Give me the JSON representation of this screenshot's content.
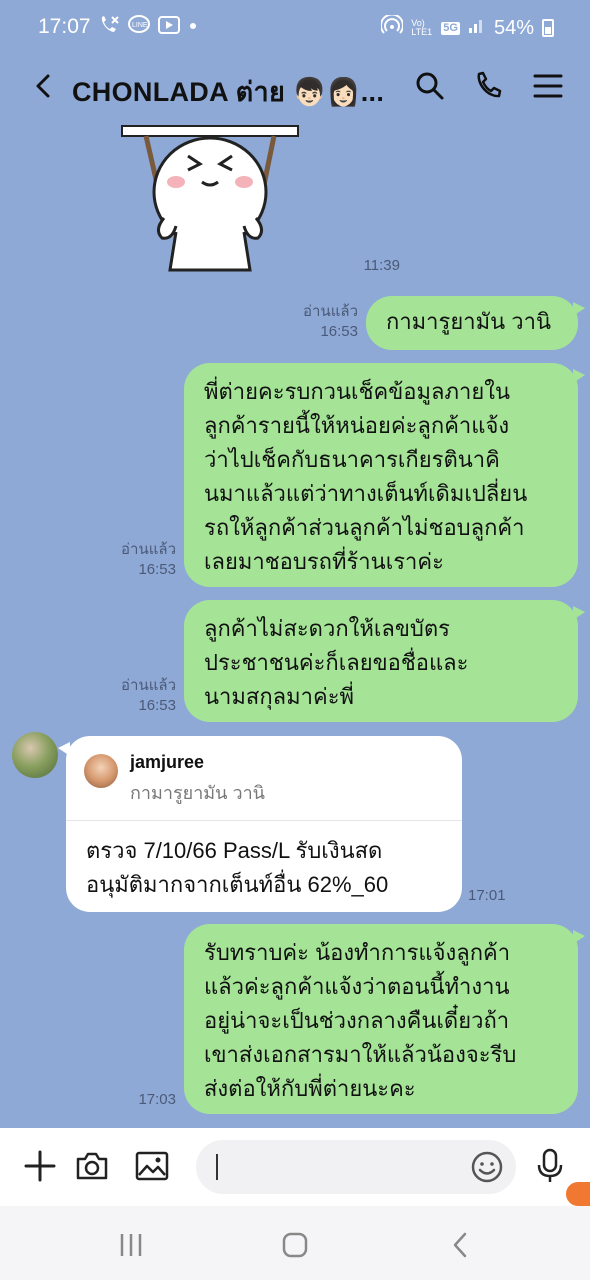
{
  "status_bar": {
    "time": "17:07",
    "battery": "54%",
    "network": "5G",
    "volte": "Vo) LTE1",
    "left_icons": [
      "missed-call-icon",
      "line-icon",
      "media-icon",
      "dot-icon"
    ],
    "right_icons": [
      "hotspot-icon",
      "volte-icon",
      "5g-icon",
      "signal-icon",
      "battery-icon"
    ]
  },
  "header": {
    "title": "CHONLADA ต่าย 👦🏻👩🏻...",
    "icons": [
      "back-icon",
      "search-icon",
      "call-icon",
      "menu-icon"
    ]
  },
  "messages": [
    {
      "type": "sticker",
      "time": "11:39"
    },
    {
      "type": "out",
      "read": "อ่านแล้ว",
      "time": "16:53",
      "text": "กามารูยามัน วานิ"
    },
    {
      "type": "out",
      "read": "อ่านแล้ว",
      "time": "16:53",
      "lines": [
        "พี่ต่ายคะรบกวนเช็คข้อมูลภายใน",
        "ลูกค้ารายนี้ให้หน่อยค่ะลูกค้าแจ้ง",
        "ว่าไปเช็คกับธนาคารเกียรตินาคิ",
        "นมาแล้วแต่ว่าทางเต็นท์เดิมเปลี่ยน",
        "รถให้ลูกค้าส่วนลูกค้าไม่ชอบลูกค้า",
        "เลยมาชอบรถที่ร้านเราค่ะ"
      ]
    },
    {
      "type": "out",
      "read": "อ่านแล้ว",
      "time": "16:53",
      "lines": [
        "ลูกค้าไม่สะดวกให้เลขบัตร",
        "ประชาชนค่ะก็เลยขอชื่อและ",
        "นามสกุลมาค่ะพี่"
      ]
    },
    {
      "type": "in_reply",
      "time": "17:01",
      "reply_name": "jamjuree",
      "reply_quote": "กามารูยามัน วานิ",
      "lines": [
        "ตรวจ 7/10/66 Pass/L รับเงินสด",
        "อนุมัติมากจากเต็นท์อื่น 62%_60"
      ]
    },
    {
      "type": "out",
      "time": "17:03",
      "lines": [
        "รับทราบค่ะ น้องทำการแจ้งลูกค้า",
        "แล้วค่ะลูกค้าแจ้งว่าตอนนี้ทำงาน",
        "อยู่น่าจะเป็นช่วงกลางคืนเดี๋ยวถ้า",
        "เขาส่งเอกสารมาให้แล้วน้องจะรีบ",
        "ส่งต่อให้กับพี่ต่ายนะคะ"
      ]
    }
  ],
  "input_bar": {
    "placeholder": "",
    "icons": [
      "plus-icon",
      "camera-icon",
      "image-icon",
      "emoji-icon",
      "mic-icon"
    ]
  },
  "nav_bar": {
    "icons": [
      "recent-apps-icon",
      "home-icon",
      "back-nav-icon"
    ]
  },
  "colors": {
    "chat_bg": "#8fa9d6",
    "bubble_out": "#a5e497",
    "bubble_in": "#ffffff"
  }
}
